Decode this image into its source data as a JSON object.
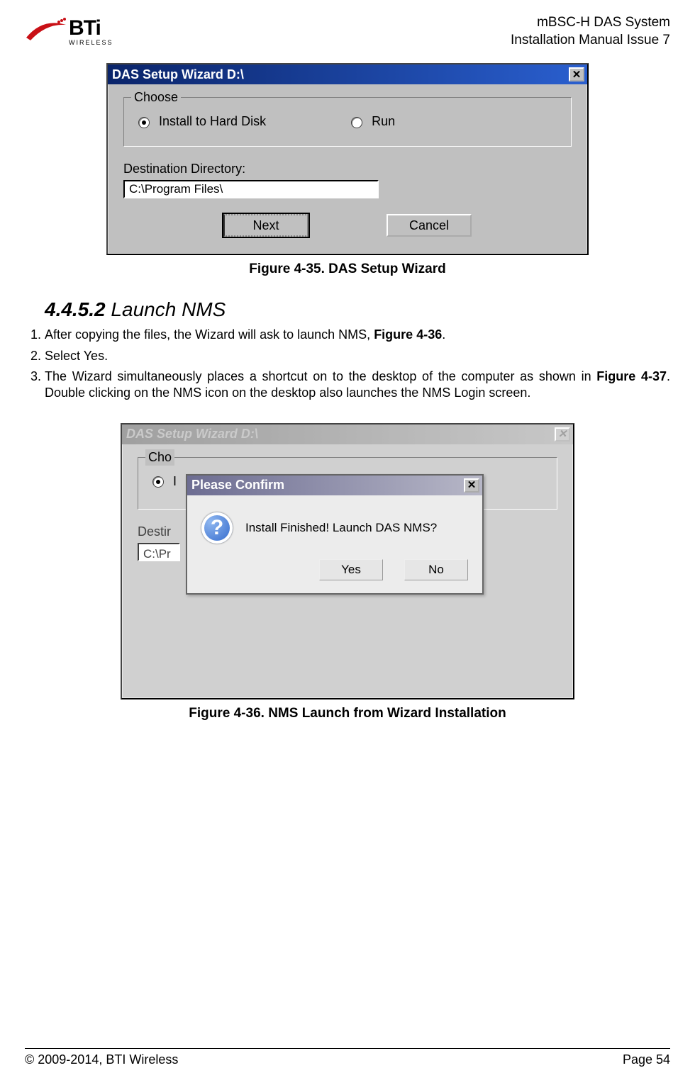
{
  "header": {
    "logo_main": "BTi",
    "logo_sub": "WIRELESS",
    "right_line1": "mBSC-H DAS System",
    "right_line2": "Installation Manual Issue 7"
  },
  "fig1": {
    "title": "DAS Setup Wizard D:\\",
    "group_label": "Choose",
    "opt_install": "Install to Hard Disk",
    "opt_run": "Run",
    "dest_label": "Destination Directory:",
    "dest_value": "C:\\Program Files\\",
    "btn_next": "Next",
    "btn_cancel": "Cancel",
    "caption": "Figure 4-35. DAS Setup Wizard"
  },
  "section": {
    "number": "4.4.5.2",
    "title": "Launch NMS",
    "step1_a": "After copying the files, the Wizard will ask to launch NMS, ",
    "step1_ref": "Figure 4-36",
    "step1_b": ".",
    "step2": "Select Yes.",
    "step3_a": "The Wizard simultaneously places a shortcut on to the desktop of the computer as shown in ",
    "step3_ref": "Figure 4-37",
    "step3_b": ". Double clicking on the NMS icon on the desktop also launches the NMS Login screen."
  },
  "fig2": {
    "parent_title": "DAS Setup Wizard D:\\",
    "parent_cho_partial": "Cho",
    "parent_opt_bullet": "I",
    "parent_dest_partial": "Destir",
    "parent_path_partial": "C:\\Pr",
    "confirm_title": "Please Confirm",
    "confirm_msg": "Install Finished! Launch DAS NMS?",
    "btn_yes": "Yes",
    "btn_no": "No",
    "caption": "Figure 4-36. NMS Launch from Wizard Installation"
  },
  "footer": {
    "left": "© 2009-2014, BTI Wireless",
    "right": "Page 54"
  }
}
